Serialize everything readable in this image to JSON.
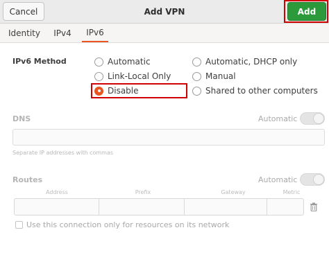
{
  "header": {
    "cancel_label": "Cancel",
    "title": "Add VPN",
    "add_label": "Add"
  },
  "tabs": [
    {
      "label": "Identity",
      "active": false
    },
    {
      "label": "IPv4",
      "active": false
    },
    {
      "label": "IPv6",
      "active": true
    }
  ],
  "ipv6": {
    "method_label": "IPv6 Method",
    "options": [
      {
        "label": "Automatic",
        "checked": false
      },
      {
        "label": "Automatic, DHCP only",
        "checked": false
      },
      {
        "label": "Link-Local Only",
        "checked": false
      },
      {
        "label": "Manual",
        "checked": false
      },
      {
        "label": "Disable",
        "checked": true
      },
      {
        "label": "Shared to other computers",
        "checked": false
      }
    ]
  },
  "dns": {
    "label": "DNS",
    "auto_label": "Automatic",
    "auto_enabled": true,
    "hint": "Separate IP addresses with commas"
  },
  "routes": {
    "label": "Routes",
    "auto_label": "Automatic",
    "auto_enabled": true,
    "columns": [
      "Address",
      "Prefix",
      "Gateway",
      "Metric"
    ],
    "only_local_label": "Use this connection only for resources on its network"
  },
  "colors": {
    "accent": "#e95420",
    "add_button": "#2c9a3a",
    "highlight": "#d00000"
  }
}
